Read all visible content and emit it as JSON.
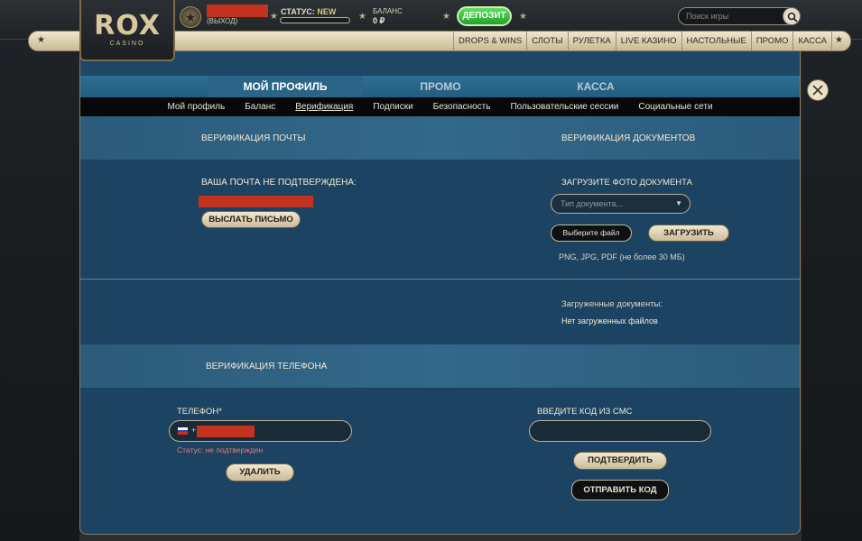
{
  "header": {
    "logo": "ROX",
    "logo_sub": "CASINO",
    "logout": "(ВЫХОД)",
    "status_label": "СТАТУС:",
    "status_value": "NEW",
    "balance_label": "БАЛАНС",
    "balance_value": "0 ₽",
    "deposit": "ДЕПОЗИТ",
    "search_placeholder": "Поиск игры"
  },
  "nav": {
    "items": [
      "DROPS & WINS",
      "СЛОТЫ",
      "РУЛЕТКА",
      "LIVE КАЗИНО",
      "НАСТОЛЬНЫЕ",
      "ПРОМО",
      "КАССА"
    ]
  },
  "modal": {
    "tabs": [
      "МОЙ ПРОФИЛЬ",
      "ПРОМО",
      "КАССА"
    ],
    "active_tab": "МОЙ ПРОФИЛЬ",
    "subnav": [
      "Мой профиль",
      "Баланс",
      "Верификация",
      "Подписки",
      "Безопасность",
      "Пользовательские сессии",
      "Социальные сети"
    ],
    "active_subnav": "Верификация",
    "email": {
      "title": "ВЕРИФИКАЦИЯ ПОЧТЫ",
      "not_confirmed": "ВАША ПОЧТА НЕ ПОДТВЕРЖДЕНА:",
      "send_button": "ВЫСЛАТЬ ПИСЬМО"
    },
    "documents": {
      "title": "ВЕРИФИКАЦИЯ ДОКУМЕНТОВ",
      "upload_label": "ЗАГРУЗИТЕ ФОТО ДОКУМЕНТА",
      "type_placeholder": "Тип документа...",
      "choose_file": "Выберите файл",
      "upload_button": "ЗАГРУЗИТЬ",
      "formats": "PNG, JPG, PDF (не более 30 МБ)",
      "uploaded_label": "Загруженные документы:",
      "no_files": "Нет загруженных файлов"
    },
    "phone": {
      "title": "ВЕРИФИКАЦИЯ ТЕЛЕФОНА",
      "phone_label": "ТЕЛЕФОН*",
      "phone_prefix": "+",
      "status": "Статус: не подтвержден",
      "delete_button": "УДАЛИТЬ",
      "sms_label": "ВВЕДИТЕ КОД ИЗ СМС",
      "confirm_button": "ПОДТВЕРДИТЬ",
      "send_code_button": "ОТПРАВИТЬ КОД"
    }
  },
  "colors": {
    "accent_green": "#21a225",
    "modal_blue": "#1d4360",
    "redaction": "#c2321e",
    "error_text": "#e57b6f"
  }
}
